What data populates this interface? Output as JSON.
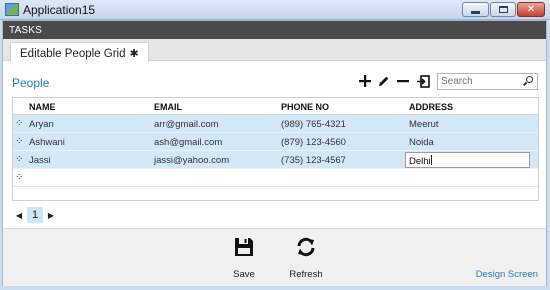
{
  "window": {
    "title": "Application15"
  },
  "tasks_bar": {
    "label": "TASKS"
  },
  "tab": {
    "label": "Editable People Grid",
    "pin": "✱"
  },
  "screen": {
    "title": "People"
  },
  "toolbar": {
    "add_icon": "plus-icon",
    "edit_icon": "pencil-icon",
    "delete_icon": "minus-icon",
    "export_icon": "export-icon"
  },
  "search": {
    "placeholder": "Search",
    "icon": "search-icon"
  },
  "grid": {
    "columns": [
      "NAME",
      "EMAIL",
      "PHONE NO",
      "ADDRESS"
    ],
    "rows": [
      {
        "name": "Aryan",
        "email": "arr@gmail.com",
        "phone": "(989) 765-4321",
        "address": "Meerut"
      },
      {
        "name": "Ashwani",
        "email": "ash@gmail.com",
        "phone": "(879) 123-4560",
        "address": "Noida"
      },
      {
        "name": "Jassi",
        "email": "jassi@yahoo.com",
        "phone": "(735) 123-4567",
        "address": "Delhi"
      }
    ]
  },
  "pager": {
    "current_page": "1"
  },
  "commands": {
    "save_label": "Save",
    "refresh_label": "Refresh"
  },
  "footer": {
    "design_link": "Design Screen"
  },
  "colors": {
    "accent": "#1e7ec3",
    "selected_row": "#d3e8f7",
    "tasks_bar": "#4a4a4a"
  }
}
